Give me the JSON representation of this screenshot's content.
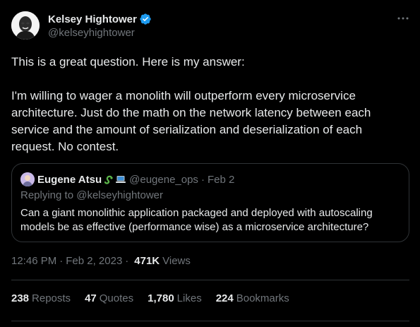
{
  "author": {
    "display_name": "Kelsey Hightower",
    "handle": "@kelseyhightower",
    "verified": true
  },
  "more_icon": "more-horizontal-icon",
  "body": {
    "paragraph_1": "This is a great question.  Here is my answer:",
    "paragraph_2": "I'm willing to wager a monolith will outperform every microservice architecture. Just do the math on the network latency between each service and the amount of serialization and deserialization of each request. No contest."
  },
  "quoted": {
    "display_name": "Eugene Atsu",
    "handle": "@eugene_ops",
    "separator": "·",
    "date": "Feb 2",
    "replying_to": "Replying to @kelseyhightower",
    "text": "Can a giant monolithic application packaged and deployed with autoscaling models be as effective (performance wise) as a microservice architecture?"
  },
  "meta": {
    "time": "12:46 PM",
    "separator": "·",
    "date": "Feb 2, 2023",
    "separator_2": "·",
    "views_count": "471K",
    "views_label": "Views"
  },
  "stats": [
    {
      "count": "238",
      "label": "Reposts"
    },
    {
      "count": "47",
      "label": "Quotes"
    },
    {
      "count": "1,780",
      "label": "Likes"
    },
    {
      "count": "224",
      "label": "Bookmarks"
    }
  ],
  "colors": {
    "background": "#000000",
    "text_primary": "#e7e9ea",
    "text_secondary": "#71767b",
    "border": "#2f3336",
    "verified_blue": "#1d9bf0"
  }
}
